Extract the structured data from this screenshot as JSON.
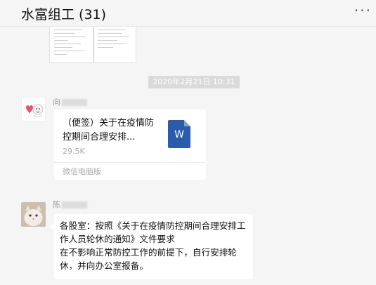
{
  "header": {
    "title": "水富组工 (31)",
    "more_icon": "more-icon",
    "more_glyph": "···"
  },
  "messages": {
    "timestamp": "2020年2月21日 10:31",
    "file_message": {
      "sender_visible": "向",
      "file_name": "（便签）关于在疫情防控期间合理安排...",
      "file_size": "29.5K",
      "source": "微信电脑版",
      "file_icon": "word-doc-icon",
      "file_icon_letter": "W",
      "file_icon_color": "#2b5cab"
    },
    "text_message": {
      "sender_visible": "陈",
      "text_line1": "各股室：按照《关于在疫情防控期间合理安排工作人员轮休的通知》文件要求",
      "text_line2": "在不影响正常防控工作的前提下，自行安排轮休，并向办公室报备。"
    }
  },
  "colors": {
    "background": "#f5f5f5",
    "bubble": "#ffffff",
    "timestamp_chip": "#dadada"
  }
}
